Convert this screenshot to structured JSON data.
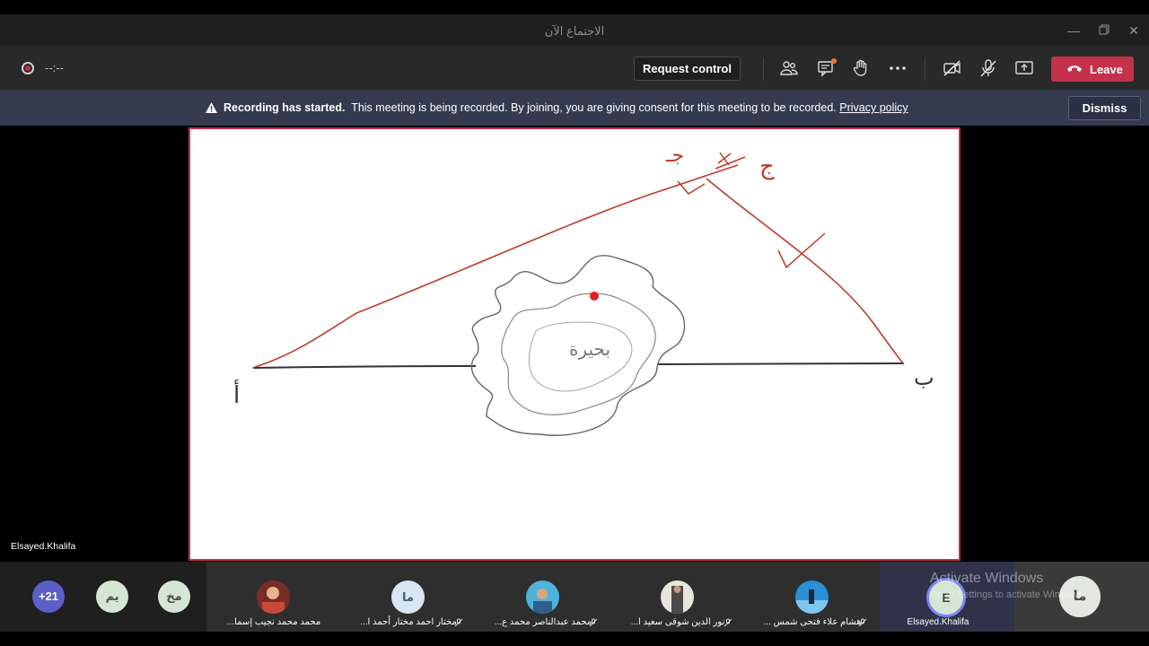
{
  "window": {
    "title": "الاجتماع الآن",
    "controls": [
      "minimize-icon",
      "restore-icon",
      "close-icon"
    ]
  },
  "toolbar": {
    "timer": "--:--",
    "request_control_label": "Request control",
    "leave_label": "Leave",
    "icons": [
      "participants-icon",
      "chat-icon",
      "raise-hand-icon",
      "more-icon",
      "camera-off-icon",
      "mic-off-icon",
      "share-icon"
    ],
    "leave_color": "#c4314b"
  },
  "banner": {
    "bold": "Recording has started.",
    "message": "This meeting is being recorded. By joining, you are giving consent for this meeting to be recorded.",
    "link": "Privacy policy",
    "dismiss_label": "Dismiss"
  },
  "stage": {
    "presenter_name": "Elsayed.Khalifa",
    "whiteboard": {
      "labels": {
        "vertex_a": "أ",
        "vertex_b": "ب",
        "top_left": "جـ",
        "top_right": "ج",
        "lake": "بحيرة"
      }
    }
  },
  "participants": {
    "overflow": "+21",
    "bubbles": [
      {
        "initials": "يم",
        "color": "#d5e7d4"
      },
      {
        "initials": "مخ",
        "color": "#d5e7d4"
      }
    ],
    "tiles": [
      {
        "name": "محمد محمد نجيب إسما...",
        "avatar": "photo"
      },
      {
        "name": "مختار احمد مختار أحمد ا...",
        "avatar": "ما"
      },
      {
        "name": "محمد عبدالناصر محمد ع...",
        "avatar": "photo"
      },
      {
        "name": "نور الدين شوقى سعيد ا...",
        "avatar": "photo"
      },
      {
        "name": "هشام علاء فتحى شمس ...",
        "avatar": "photo"
      }
    ],
    "self": {
      "name": "Elsayed.Khalifa",
      "initial": "E"
    },
    "last_initials": "ما"
  },
  "watermark": {
    "line1": "Activate Windows",
    "line2": "Go to Settings to activate Windows."
  }
}
